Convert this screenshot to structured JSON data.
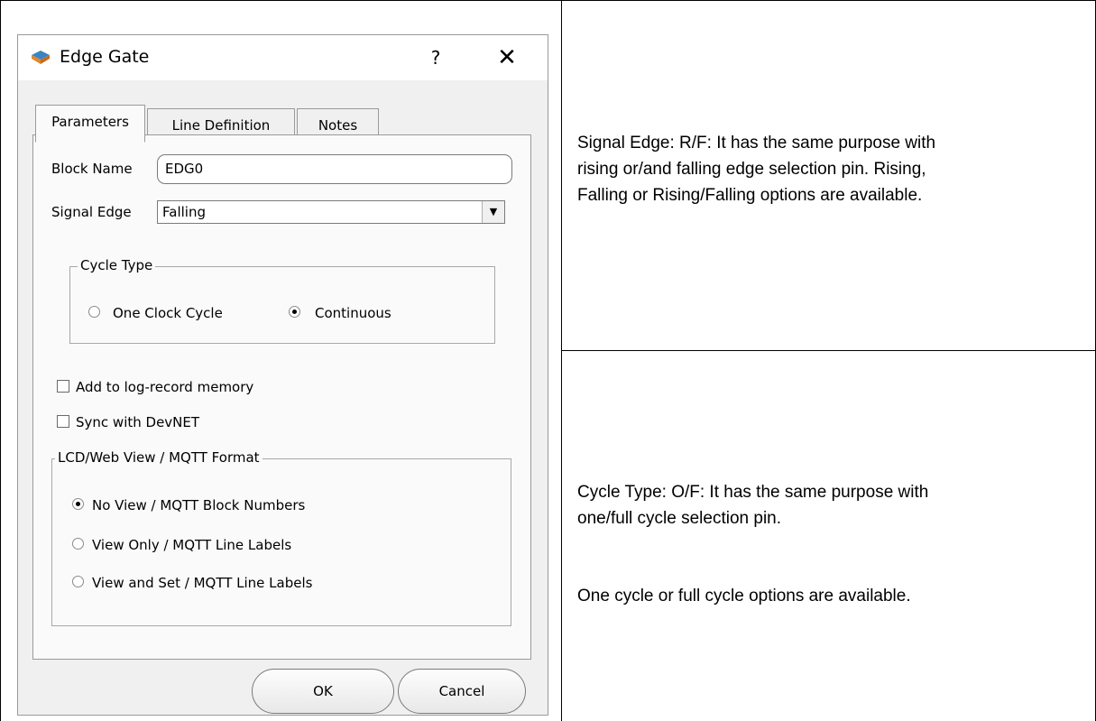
{
  "dialog": {
    "title": "Edge Gate",
    "help_label": "?",
    "close_label": "✕",
    "tabs": [
      {
        "label": "Parameters"
      },
      {
        "label": "Line Definition"
      },
      {
        "label": "Notes"
      }
    ],
    "block_name_label": "Block Name",
    "block_name_value": "EDG0",
    "signal_edge_label": "Signal Edge",
    "signal_edge_value": "Falling",
    "cycle_type": {
      "legend": "Cycle Type",
      "options": [
        {
          "label": "One Clock Cycle",
          "checked": false
        },
        {
          "label": "Continuous",
          "checked": true
        }
      ]
    },
    "log_record_label": "Add to log-record memory",
    "sync_devnet_label": "Sync with DevNET",
    "view_format": {
      "legend": "LCD/Web View / MQTT Format",
      "options": [
        {
          "label": "No View / MQTT Block Numbers",
          "checked": true
        },
        {
          "label": "View Only / MQTT Line Labels",
          "checked": false
        },
        {
          "label": "View and Set / MQTT Line Labels",
          "checked": false
        }
      ]
    },
    "ok_label": "OK",
    "cancel_label": "Cancel"
  },
  "description": {
    "signal_edge_lines": [
      "Signal Edge:  R/F: It has the same purpose with",
      "rising or/and falling edge selection pin. Rising,",
      "Falling or Rising/Falling options are available."
    ],
    "cycle_type_lines": [
      "Cycle Type:  O/F: It has the same purpose with",
      "one/full cycle selection pin."
    ],
    "cycle_options_line": "One cycle or full cycle options are available."
  }
}
